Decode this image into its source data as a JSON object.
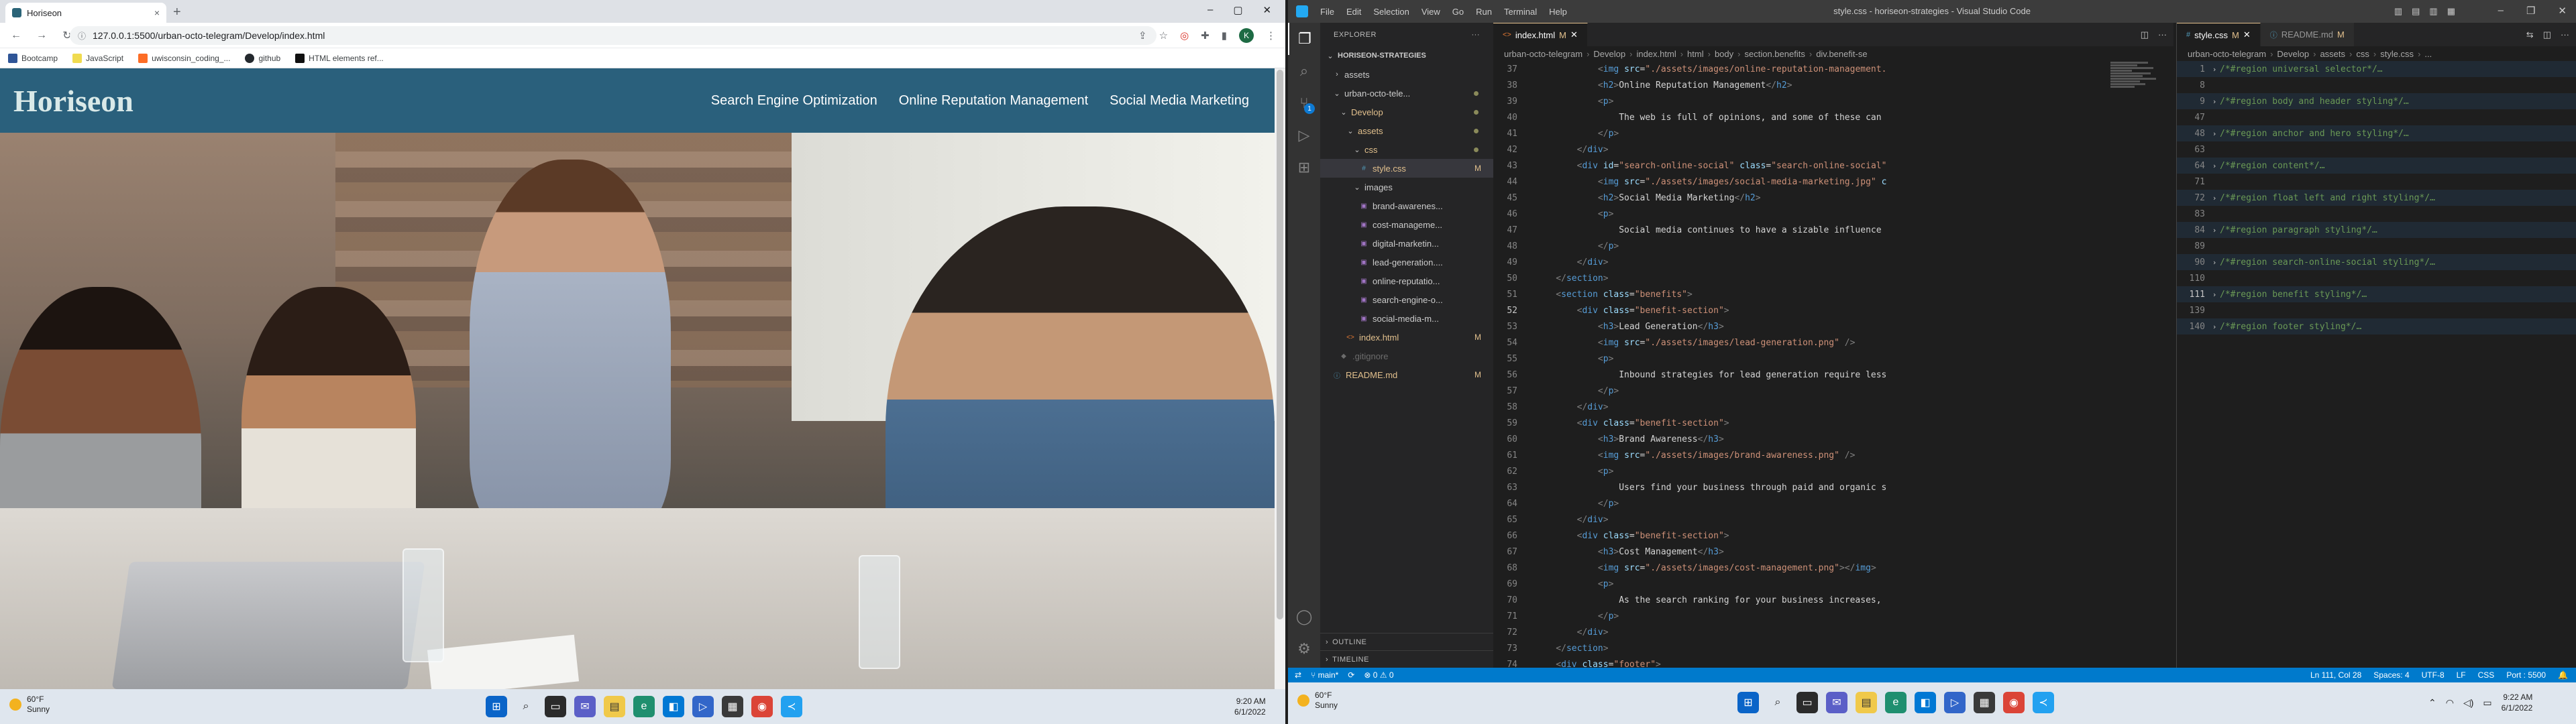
{
  "browser": {
    "tab_title": "Horiseon",
    "tab_close": "×",
    "new_tab": "+",
    "url": "127.0.0.1:5500/urban-octo-telegram/Develop/index.html",
    "profile_initial": "K",
    "bookmarks": [
      "Bootcamp",
      "JavaScript",
      "uwisconsin_coding_...",
      "github",
      "HTML elements ref..."
    ]
  },
  "site": {
    "logo": "Horiseon",
    "nav": [
      "Search Engine Optimization",
      "Online Reputation Management",
      "Social Media Marketing"
    ]
  },
  "taskbar_left": {
    "temp": "60°F",
    "condition": "Sunny",
    "time": "9:20 AM",
    "date": "6/1/2022"
  },
  "vscode": {
    "title": "style.css - horiseon-strategies - Visual Studio Code",
    "menu": [
      "File",
      "Edit",
      "Selection",
      "View",
      "Go",
      "Run",
      "Terminal",
      "Help"
    ],
    "explorer_title": "EXPLORER",
    "more": "···",
    "scm_badge": "1",
    "tree": [
      {
        "label": "HORISEON-STRATEGIES",
        "indent": 0,
        "chev": "⌄",
        "bold": true
      },
      {
        "label": "assets",
        "indent": 1,
        "chev": "›"
      },
      {
        "label": "urban-octo-tele...",
        "indent": 1,
        "chev": "⌄",
        "dot": true
      },
      {
        "label": "Develop",
        "indent": 2,
        "chev": "⌄",
        "dot": true,
        "modified": true
      },
      {
        "label": "assets",
        "indent": 3,
        "chev": "⌄",
        "dot": true,
        "modified": true
      },
      {
        "label": "css",
        "indent": 4,
        "chev": "⌄",
        "dot": true,
        "modified": true
      },
      {
        "label": "style.css",
        "indent": 5,
        "icon": "#",
        "status": "M",
        "modified": true,
        "selected": true
      },
      {
        "label": "images",
        "indent": 4,
        "chev": "⌄"
      },
      {
        "label": "brand-awarenes...",
        "indent": 5,
        "icon": "▣"
      },
      {
        "label": "cost-manageme...",
        "indent": 5,
        "icon": "▣"
      },
      {
        "label": "digital-marketin...",
        "indent": 5,
        "icon": "▣"
      },
      {
        "label": "lead-generation....",
        "indent": 5,
        "icon": "▣"
      },
      {
        "label": "online-reputatio...",
        "indent": 5,
        "icon": "▣"
      },
      {
        "label": "search-engine-o...",
        "indent": 5,
        "icon": "▣"
      },
      {
        "label": "social-media-m...",
        "indent": 5,
        "icon": "▣"
      },
      {
        "label": "index.html",
        "indent": 3,
        "icon": "<>",
        "status": "M",
        "modified": true
      },
      {
        "label": ".gitignore",
        "indent": 2,
        "icon": "◆",
        "git": true
      },
      {
        "label": "README.md",
        "indent": 1,
        "icon": "ⓘ",
        "status": "M",
        "modified": true
      }
    ],
    "outline": "OUTLINE",
    "timeline": "TIMELINE",
    "editor1": {
      "tabs": [
        {
          "label": "index.html",
          "badge": "M",
          "kind": "html",
          "active": true
        }
      ],
      "breadcrumbs": [
        "urban-octo-telegram",
        "Develop",
        "index.html",
        "html",
        "body",
        "section.benefits",
        "div.benefit-se"
      ],
      "lines": [
        {
          "n": "37",
          "html": "<span class='tg'>            &lt;</span><span class='tn'>img</span> <span class='an'>src</span>=<span class='av'>\"./assets/images/online-reputation-management.</span>"
        },
        {
          "n": "38",
          "html": "<span class='tg'>            &lt;</span><span class='tn'>h2</span><span class='tg'>&gt;</span><span class='tx'>Online Reputation Management</span><span class='tg'>&lt;/</span><span class='tn'>h2</span><span class='tg'>&gt;</span>"
        },
        {
          "n": "39",
          "html": "<span class='tg'>            &lt;</span><span class='tn'>p</span><span class='tg'>&gt;</span>"
        },
        {
          "n": "40",
          "html": "<span class='tx'>                The web is full of opinions, and some of these can</span>"
        },
        {
          "n": "41",
          "html": "<span class='tg'>            &lt;/</span><span class='tn'>p</span><span class='tg'>&gt;</span>"
        },
        {
          "n": "42",
          "html": "<span class='tg'>        &lt;/</span><span class='tn'>div</span><span class='tg'>&gt;</span>"
        },
        {
          "n": "43",
          "html": "<span class='tg'>        &lt;</span><span class='tn'>div</span> <span class='an'>id</span>=<span class='av'>\"search-online-social\"</span> <span class='an'>class</span>=<span class='av'>\"search-online-social\"</span>"
        },
        {
          "n": "44",
          "html": "<span class='tg'>            &lt;</span><span class='tn'>img</span> <span class='an'>src</span>=<span class='av'>\"./assets/images/social-media-marketing.jpg\"</span> <span class='an'>c</span>"
        },
        {
          "n": "45",
          "html": "<span class='tg'>            &lt;</span><span class='tn'>h2</span><span class='tg'>&gt;</span><span class='tx'>Social Media Marketing</span><span class='tg'>&lt;/</span><span class='tn'>h2</span><span class='tg'>&gt;</span>"
        },
        {
          "n": "46",
          "html": "<span class='tg'>            &lt;</span><span class='tn'>p</span><span class='tg'>&gt;</span>"
        },
        {
          "n": "47",
          "html": "<span class='tx'>                Social media continues to have a sizable influence</span>"
        },
        {
          "n": "48",
          "html": "<span class='tg'>            &lt;/</span><span class='tn'>p</span><span class='tg'>&gt;</span>"
        },
        {
          "n": "49",
          "html": "<span class='tg'>        &lt;/</span><span class='tn'>div</span><span class='tg'>&gt;</span>"
        },
        {
          "n": "50",
          "html": "<span class='tg'>    &lt;/</span><span class='tn'>section</span><span class='tg'>&gt;</span>"
        },
        {
          "n": "51",
          "html": "<span class='tg'>    &lt;</span><span class='tn'>section</span> <span class='an'>class</span>=<span class='av'>\"benefits\"</span><span class='tg'>&gt;</span>"
        },
        {
          "n": "52",
          "html": "<span class='tg'>        &lt;</span><span class='tn'>div</span> <span class='an'>class</span>=<span class='av'>\"benefit-section\"</span><span class='tg'>&gt;</span>"
        },
        {
          "n": "53",
          "html": "<span class='tg'>            &lt;</span><span class='tn'>h3</span><span class='tg'>&gt;</span><span class='tx'>Lead Generation</span><span class='tg'>&lt;/</span><span class='tn'>h3</span><span class='tg'>&gt;</span>"
        },
        {
          "n": "54",
          "html": "<span class='tg'>            &lt;</span><span class='tn'>img</span> <span class='an'>src</span>=<span class='av'>\"./assets/images/lead-generation.png\"</span> <span class='tg'>/&gt;</span>"
        },
        {
          "n": "55",
          "html": "<span class='tg'>            &lt;</span><span class='tn'>p</span><span class='tg'>&gt;</span>"
        },
        {
          "n": "56",
          "html": "<span class='tx'>                Inbound strategies for lead generation require less</span>"
        },
        {
          "n": "57",
          "html": "<span class='tg'>            &lt;/</span><span class='tn'>p</span><span class='tg'>&gt;</span>"
        },
        {
          "n": "58",
          "html": "<span class='tg'>        &lt;/</span><span class='tn'>div</span><span class='tg'>&gt;</span>"
        },
        {
          "n": "59",
          "html": "<span class='tg'>        &lt;</span><span class='tn'>div</span> <span class='an'>class</span>=<span class='av'>\"benefit-section\"</span><span class='tg'>&gt;</span>"
        },
        {
          "n": "60",
          "html": "<span class='tg'>            &lt;</span><span class='tn'>h3</span><span class='tg'>&gt;</span><span class='tx'>Brand Awareness</span><span class='tg'>&lt;/</span><span class='tn'>h3</span><span class='tg'>&gt;</span>"
        },
        {
          "n": "61",
          "html": "<span class='tg'>            &lt;</span><span class='tn'>img</span> <span class='an'>src</span>=<span class='av'>\"./assets/images/brand-awareness.png\"</span> <span class='tg'>/&gt;</span>"
        },
        {
          "n": "62",
          "html": "<span class='tg'>            &lt;</span><span class='tn'>p</span><span class='tg'>&gt;</span>"
        },
        {
          "n": "63",
          "html": "<span class='tx'>                Users find your business through paid and organic s</span>"
        },
        {
          "n": "64",
          "html": "<span class='tg'>            &lt;/</span><span class='tn'>p</span><span class='tg'>&gt;</span>"
        },
        {
          "n": "65",
          "html": "<span class='tg'>        &lt;/</span><span class='tn'>div</span><span class='tg'>&gt;</span>"
        },
        {
          "n": "66",
          "html": "<span class='tg'>        &lt;</span><span class='tn'>div</span> <span class='an'>class</span>=<span class='av'>\"benefit-section\"</span><span class='tg'>&gt;</span>"
        },
        {
          "n": "67",
          "html": "<span class='tg'>            &lt;</span><span class='tn'>h3</span><span class='tg'>&gt;</span><span class='tx'>Cost Management</span><span class='tg'>&lt;/</span><span class='tn'>h3</span><span class='tg'>&gt;</span>"
        },
        {
          "n": "68",
          "html": "<span class='tg'>            &lt;</span><span class='tn'>img</span> <span class='an'>src</span>=<span class='av'>\"./assets/images/cost-management.png\"</span><span class='tg'>&gt;&lt;/</span><span class='tn'>img</span><span class='tg'>&gt;</span>"
        },
        {
          "n": "69",
          "html": "<span class='tg'>            &lt;</span><span class='tn'>p</span><span class='tg'>&gt;</span>"
        },
        {
          "n": "70",
          "html": "<span class='tx'>                As the search ranking for your business increases,</span>"
        },
        {
          "n": "71",
          "html": "<span class='tg'>            &lt;/</span><span class='tn'>p</span><span class='tg'>&gt;</span>"
        },
        {
          "n": "72",
          "html": "<span class='tg'>        &lt;/</span><span class='tn'>div</span><span class='tg'>&gt;</span>"
        },
        {
          "n": "73",
          "html": "<span class='tg'>    &lt;/</span><span class='tn'>section</span><span class='tg'>&gt;</span>"
        },
        {
          "n": "74",
          "html": "<span class='tg'>    &lt;</span><span class='tn'>div</span> <span class='an'>class</span>=<span class='av'>\"footer\"</span><span class='tg'>&gt;</span>"
        }
      ]
    },
    "editor2": {
      "tabs": [
        {
          "label": "style.css",
          "badge": "M",
          "kind": "css",
          "active": true
        },
        {
          "label": "README.md",
          "badge": "M",
          "kind": "md",
          "active": false
        }
      ],
      "breadcrumbs": [
        "urban-octo-telegram",
        "Develop",
        "assets",
        "css",
        "style.css",
        "..."
      ],
      "lines": [
        {
          "n": "1",
          "text": "/*#region universal selector*/…"
        },
        {
          "n": "8",
          "text": ""
        },
        {
          "n": "9",
          "text": "/*#region body and header styling*/…"
        },
        {
          "n": "47",
          "text": ""
        },
        {
          "n": "48",
          "text": "/*#region anchor and hero styling*/…"
        },
        {
          "n": "63",
          "text": ""
        },
        {
          "n": "64",
          "text": "/*#region content*/…"
        },
        {
          "n": "71",
          "text": ""
        },
        {
          "n": "72",
          "text": "/*#region float left and right styling*/…"
        },
        {
          "n": "83",
          "text": ""
        },
        {
          "n": "84",
          "text": "/*#region paragraph styling*/…"
        },
        {
          "n": "89",
          "text": ""
        },
        {
          "n": "90",
          "text": "/*#region search-online-social styling*/…"
        },
        {
          "n": "110",
          "text": ""
        },
        {
          "n": "111",
          "text": "/*#region benefit styling*/…"
        },
        {
          "n": "139",
          "text": ""
        },
        {
          "n": "140",
          "text": "/*#region footer styling*/…"
        }
      ]
    },
    "status": {
      "branch": "main*",
      "sync": "⟳",
      "problems": "⊗ 0  ⚠ 0",
      "cursor": "Ln 111, Col 28",
      "spaces": "Spaces: 4",
      "encoding": "UTF-8",
      "eol": "LF",
      "language": "CSS",
      "port": "Port : 5500"
    }
  },
  "taskbar_right": {
    "temp": "60°F",
    "condition": "Sunny",
    "time": "9:22 AM",
    "date": "6/1/2022"
  }
}
